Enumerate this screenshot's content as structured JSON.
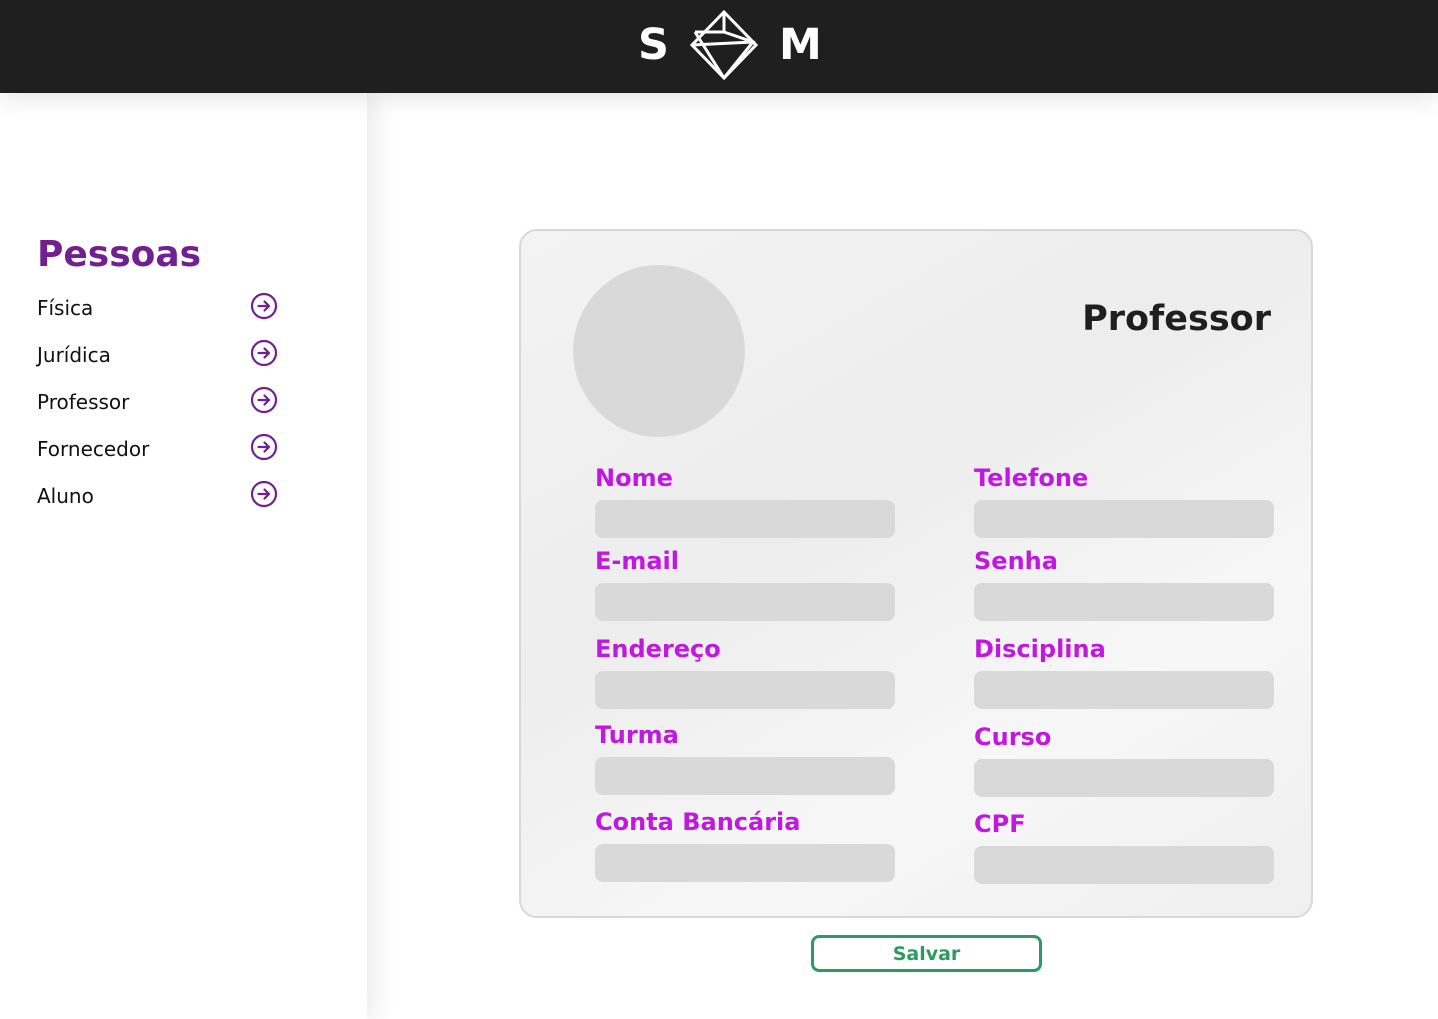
{
  "header": {
    "logo_left": "S",
    "logo_right": "M",
    "logo_mark_icon": "diamond-logo-icon"
  },
  "sidebar": {
    "title": "Pessoas",
    "items": [
      {
        "label": "Física",
        "icon": "arrow-right-circle-icon"
      },
      {
        "label": "Jurídica",
        "icon": "arrow-right-circle-icon"
      },
      {
        "label": "Professor",
        "icon": "arrow-right-circle-icon"
      },
      {
        "label": "Fornecedor",
        "icon": "arrow-right-circle-icon"
      },
      {
        "label": "Aluno",
        "icon": "arrow-right-circle-icon"
      }
    ]
  },
  "form": {
    "title": "Professor",
    "fields": {
      "nome": {
        "label": "Nome",
        "value": ""
      },
      "telefone": {
        "label": "Telefone",
        "value": ""
      },
      "email": {
        "label": "E-mail",
        "value": ""
      },
      "senha": {
        "label": "Senha",
        "value": ""
      },
      "endereco": {
        "label": "Endereço",
        "value": ""
      },
      "disciplina": {
        "label": "Disciplina",
        "value": ""
      },
      "turma": {
        "label": "Turma",
        "value": ""
      },
      "curso": {
        "label": "Curso",
        "value": ""
      },
      "conta_bancaria": {
        "label": "Conta Bancária",
        "value": ""
      },
      "cpf": {
        "label": "CPF",
        "value": ""
      }
    },
    "save_label": "Salvar"
  },
  "colors": {
    "header_bg": "#1f1f1f",
    "sidebar_title": "#72208f",
    "field_label": "#c118e0",
    "save_accent": "#2d9a62",
    "input_bg": "#d9d9d9"
  }
}
